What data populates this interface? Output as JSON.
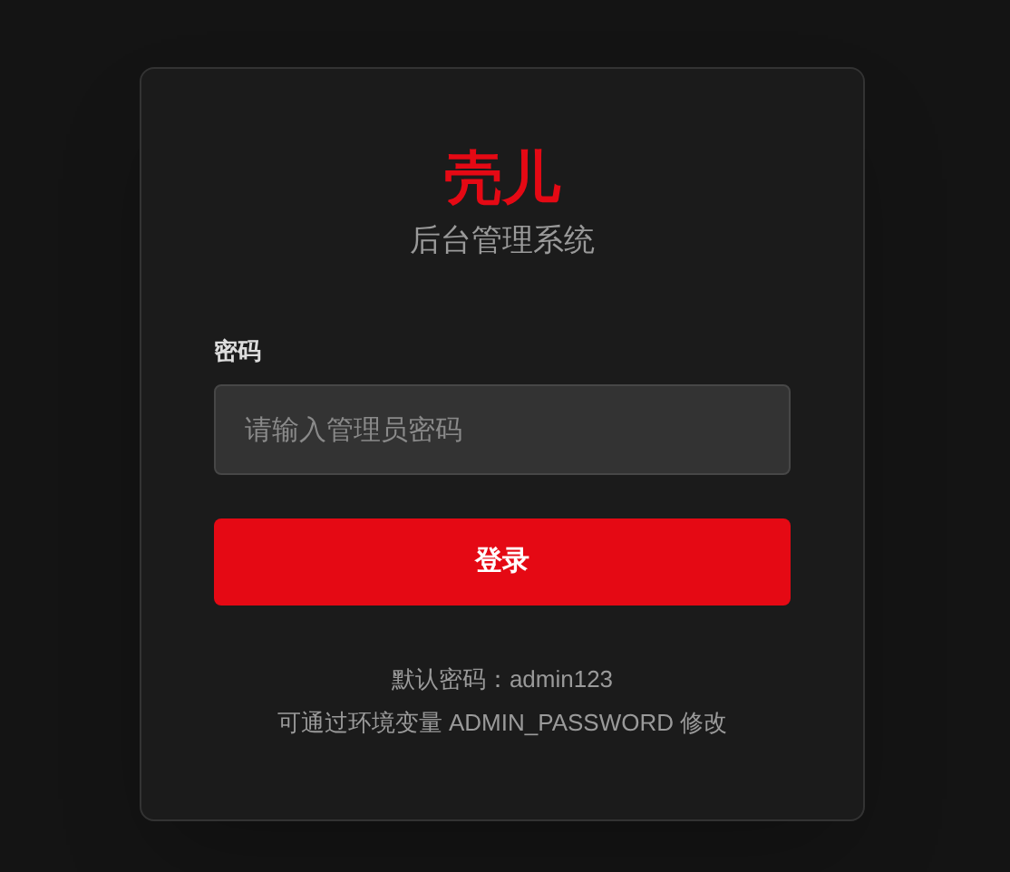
{
  "brand": {
    "title": "壳儿",
    "subtitle": "后台管理系统"
  },
  "password": {
    "label": "密码",
    "placeholder": "请输入管理员密码"
  },
  "login_button": {
    "label": "登录"
  },
  "hints": [
    "默认密码：admin123",
    "可通过环境变量 ADMIN_PASSWORD 修改"
  ]
}
